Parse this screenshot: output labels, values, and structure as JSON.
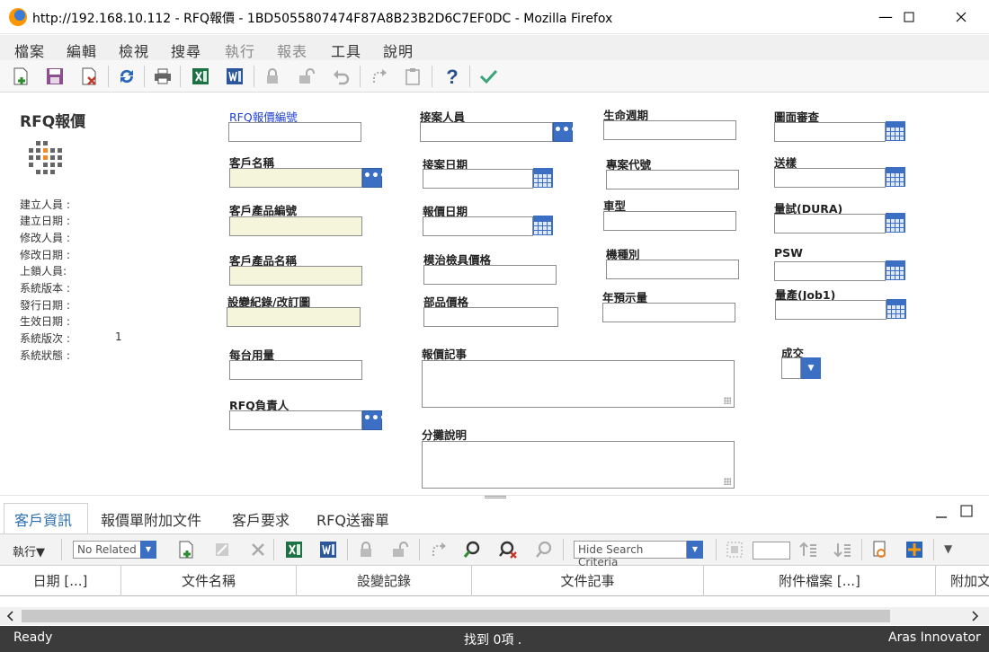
{
  "window": {
    "title": "http://192.168.10.112 - RFQ報價 - 1BD5055807474F87A8B23B2D6C7EF0DC - Mozilla Firefox",
    "minimize": "—",
    "maximize": "☐",
    "close": "✕"
  },
  "menu": [
    "檔案",
    "編輯",
    "檢視",
    "搜尋",
    "執行",
    "報表",
    "工具",
    "說明"
  ],
  "item": {
    "title": "RFQ報價",
    "sys_labels": [
      "建立人員 :",
      "建立日期 :",
      "修改人員 :",
      "修改日期 :",
      "上鎖人員:",
      "系統版本 :",
      "發行日期 :",
      "生效日期 :",
      "系統版次 :",
      "系統狀態 :"
    ],
    "sys_generation": "1"
  },
  "form": {
    "rfq_number": "RFQ報價編號",
    "customer_name": "客戶名稱",
    "customer_part_no": "客戶產品編號",
    "customer_part_name": "客戶產品名稱",
    "ecn": "設變紀錄/改訂圖",
    "daily_usage": "每台用量",
    "rfq_owner": "RFQ負責人",
    "receiver": "接案人員",
    "receive_date": "接案日期",
    "quote_date": "報價日期",
    "tooling_price": "模治檢具價格",
    "part_price": "部品價格",
    "quote_note": "報價記事",
    "split_desc": "分攤說明",
    "lifecycle": "生命週期",
    "project_code": "專案代號",
    "car_type": "車型",
    "model_type": "機種別",
    "annual_forecast": "年預示量",
    "drawing_review": "圖面審查",
    "sample": "送樣",
    "trial": "量試(DURA)",
    "psw": "PSW",
    "mass_production": "量產(Job1)",
    "deal": "成交",
    "lookup_glyph": "•••",
    "dropdown_glyph": "▼"
  },
  "tabs": [
    "客戶資訊",
    "報價單附加文件",
    "客戶要求",
    "RFQ送審單"
  ],
  "relationship_toolbar": {
    "action_label": "執行▼",
    "related_option": "No Related",
    "search_mode": "Hide Search Criteria"
  },
  "grid": {
    "columns": [
      "日期 [...]",
      "文件名稱",
      "設變記錄",
      "文件記事",
      "附件檔案 [...]",
      "附加文"
    ]
  },
  "status": {
    "left": "Ready",
    "center": "找到 0項 .",
    "right": "Aras Innovator"
  },
  "colors": {
    "accent": "#3a6fc4",
    "link": "#1e3fd6",
    "required_field": "#f5f5dc",
    "status_bar": "#3b3b3b"
  }
}
